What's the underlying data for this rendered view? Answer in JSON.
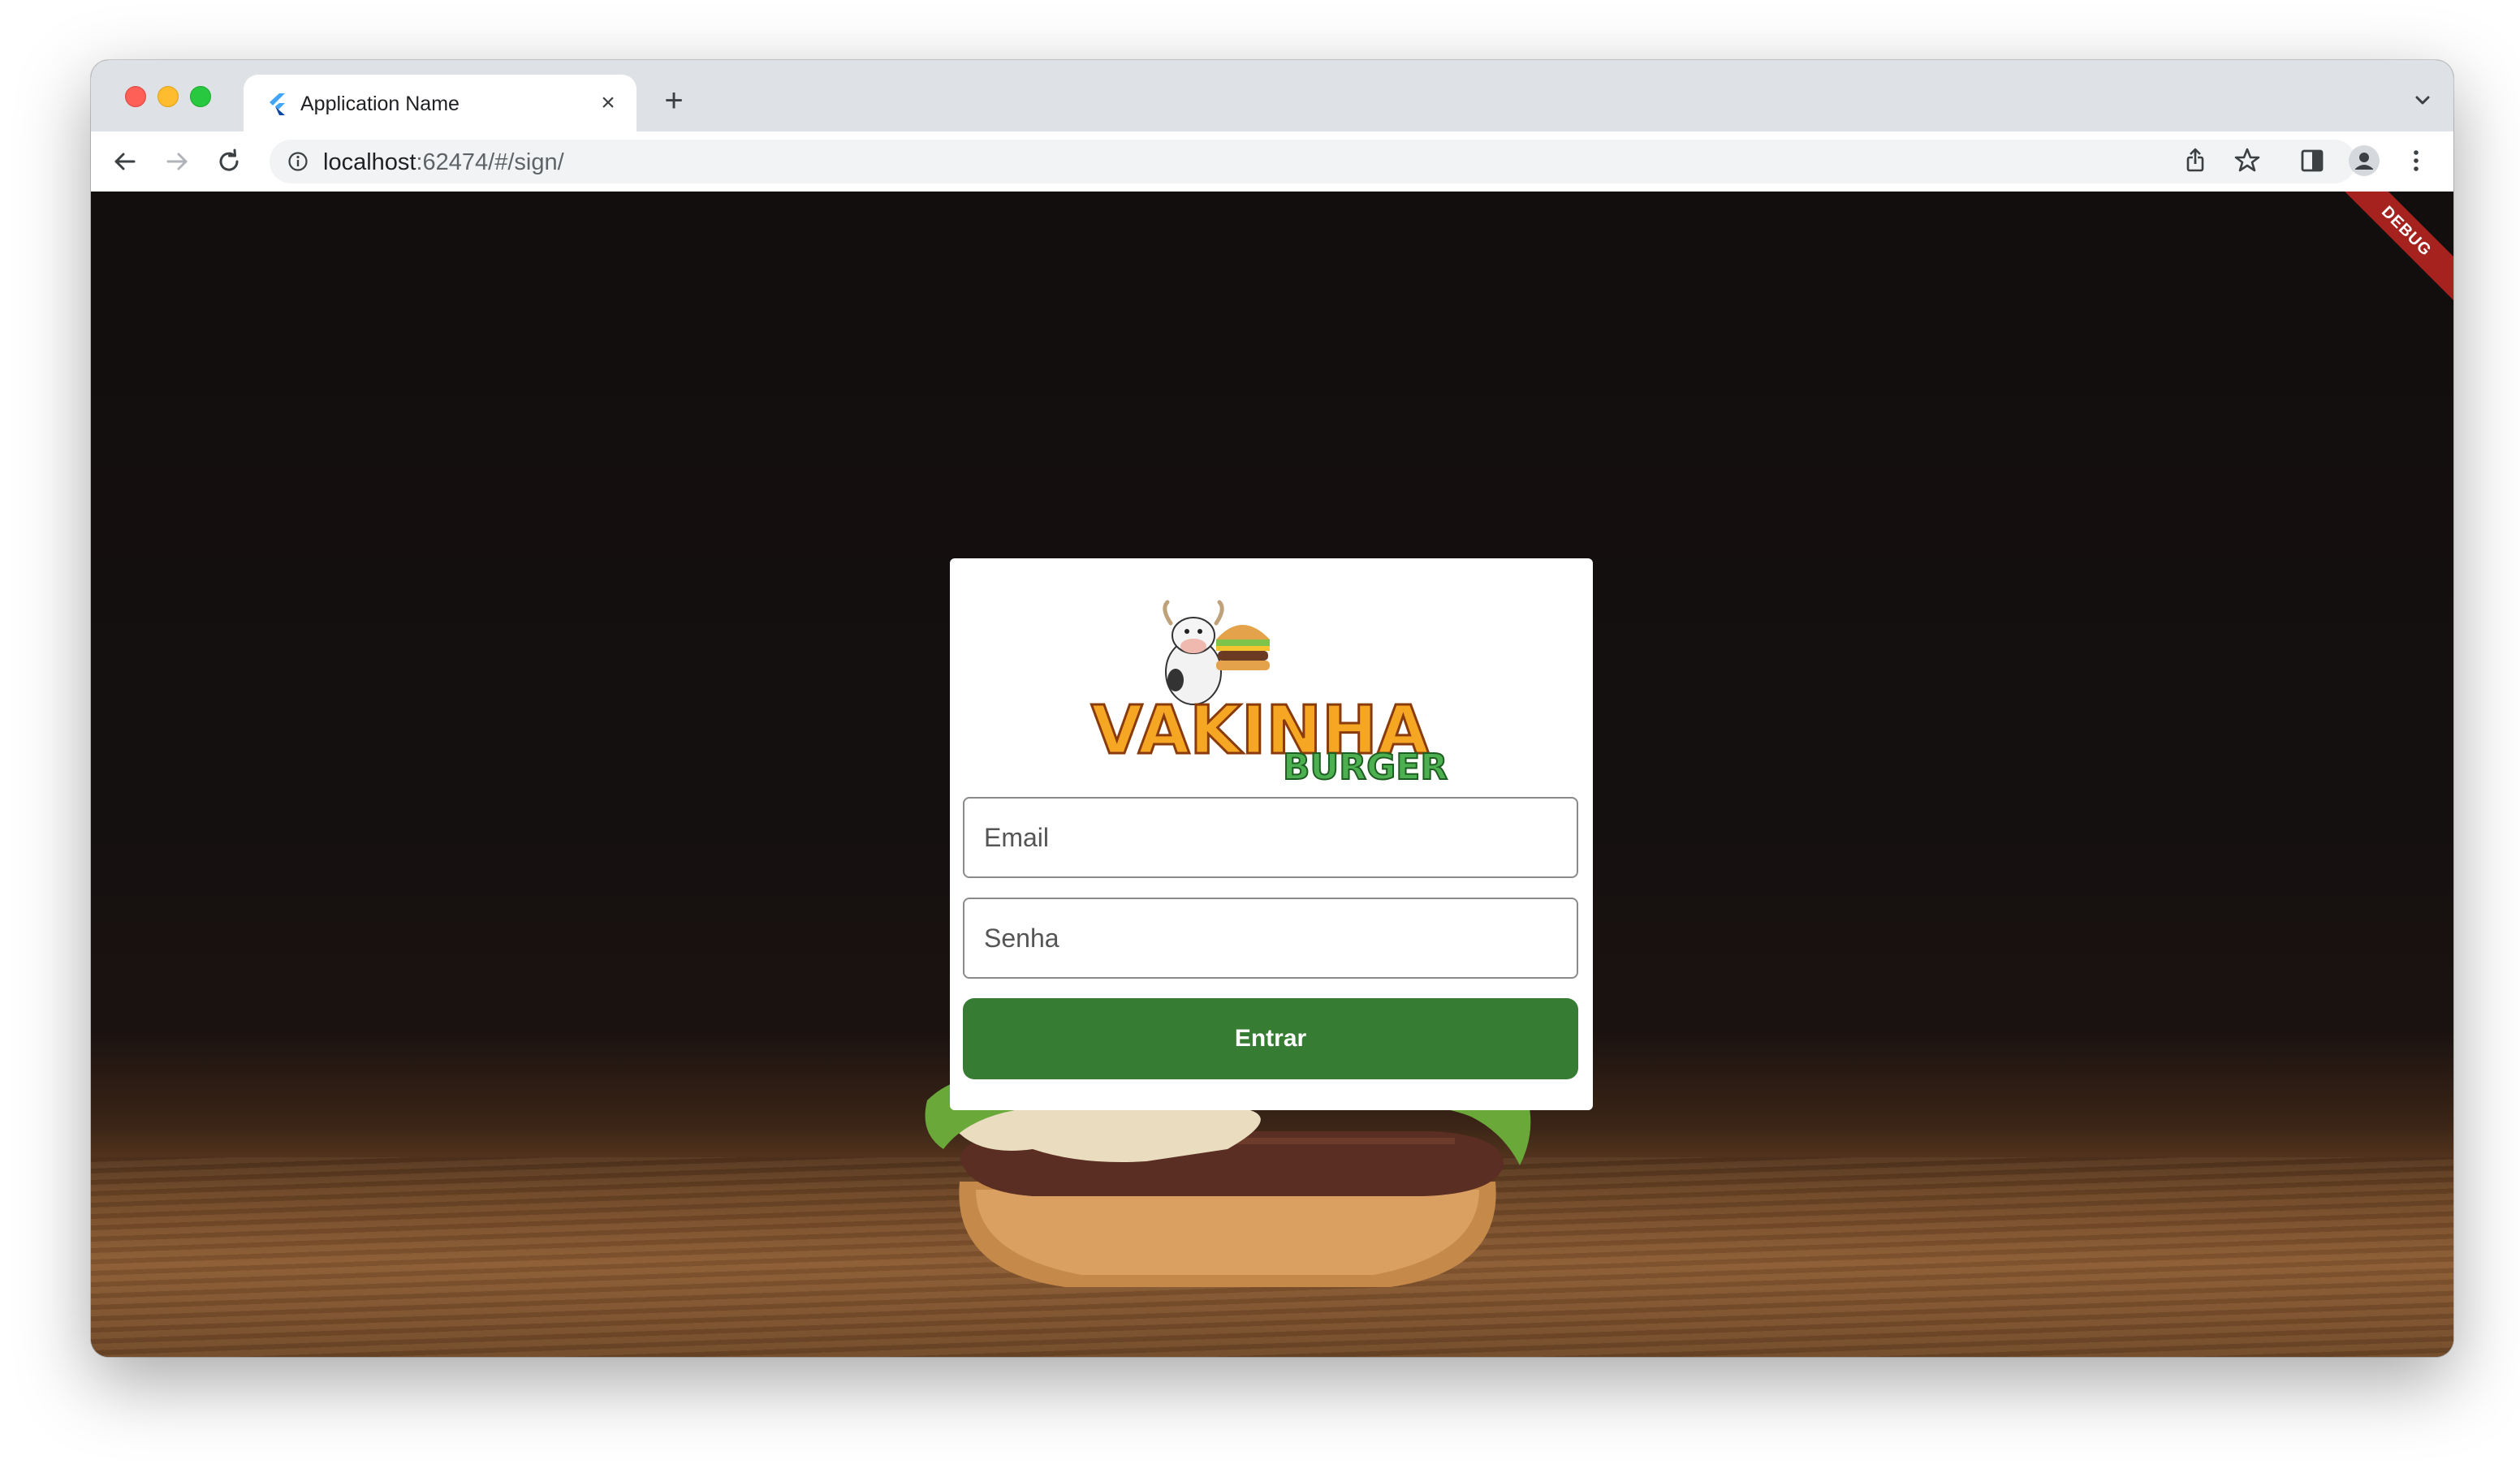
{
  "browser": {
    "tab": {
      "title": "Application Name",
      "close_symbol": "×",
      "favicon": "flutter-logo-icon"
    },
    "new_tab_symbol": "+",
    "address": {
      "host": "localhost",
      "rest": ":62474/#/sign/"
    }
  },
  "page": {
    "debug_banner": "DEBUG",
    "brand_logo_text": [
      "VAKINHA",
      "BURGER"
    ],
    "login": {
      "email_placeholder": "Email",
      "password_placeholder": "Senha",
      "submit_label": "Entrar"
    }
  },
  "colors": {
    "accent_green": "#367c32",
    "debug_red": "#a5221f",
    "background_dark": "#141010"
  }
}
